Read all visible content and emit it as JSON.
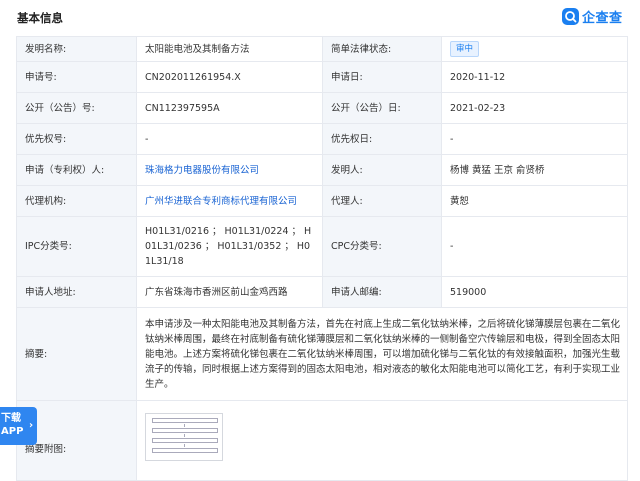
{
  "header": {
    "title": "基本信息",
    "logo_text": "企查查",
    "logo_icon": "qichacha-logo-icon"
  },
  "rows": {
    "invention_name": {
      "label": "发明名称:",
      "value": "太阳能电池及其制备方法"
    },
    "legal_status": {
      "label": "简单法律状态:",
      "value": "审中"
    },
    "app_no": {
      "label": "申请号:",
      "value": "CN202011261954.X"
    },
    "app_date": {
      "label": "申请日:",
      "value": "2020-11-12"
    },
    "pub_no": {
      "label": "公开（公告）号:",
      "value": "CN112397595A"
    },
    "pub_date": {
      "label": "公开（公告）日:",
      "value": "2021-02-23"
    },
    "priority_no": {
      "label": "优先权号:",
      "value": "-"
    },
    "priority_date": {
      "label": "优先权日:",
      "value": "-"
    },
    "applicant": {
      "label": "申请（专利权）人:",
      "value": "珠海格力电器股份有限公司"
    },
    "inventor": {
      "label": "发明人:",
      "value": "杨博 黄猛 王京 俞贤桥"
    },
    "agency": {
      "label": "代理机构:",
      "value": "广州华进联合专利商标代理有限公司"
    },
    "agent": {
      "label": "代理人:",
      "value": "黄恕"
    },
    "ipc": {
      "label": "IPC分类号:",
      "value": "H01L31/0216 ； H01L31/0224 ； H01L31/0236 ； H01L31/0352 ； H01L31/18"
    },
    "cpc": {
      "label": "CPC分类号:",
      "value": "-"
    },
    "applicant_address": {
      "label": "申请人地址:",
      "value": "广东省珠海市香洲区前山金鸡西路"
    },
    "applicant_zip": {
      "label": "申请人邮编:",
      "value": "519000"
    },
    "abstract": {
      "label": "摘要:",
      "value": "本申请涉及一种太阳能电池及其制备方法，首先在衬底上生成二氧化钛纳米棒，之后将硫化锑薄膜层包裹在二氧化钛纳米棒周围，最终在衬底制备有硫化锑薄膜层和二氧化钛纳米棒的一侧制备空穴传输层和电极，得到全固态太阳能电池。上述方案将硫化锑包裹在二氧化钛纳米棒周围，可以增加硫化锑与二氧化钛的有效接触面积，加强光生载流子的传输，同时根据上述方案得到的固态太阳电池，相对液态的敏化太阳能电池可以简化工艺，有利于实现工业生产。"
    },
    "abstract_figure": {
      "label": "摘要附图:"
    }
  },
  "download_button": {
    "line1": "下载",
    "line2": "APP",
    "icon": "chevron-right-icon"
  },
  "colors": {
    "accent": "#1a7ff0",
    "link": "#1a64d3",
    "label_bg": "#f3f6fa",
    "border": "#e6e9ef"
  }
}
